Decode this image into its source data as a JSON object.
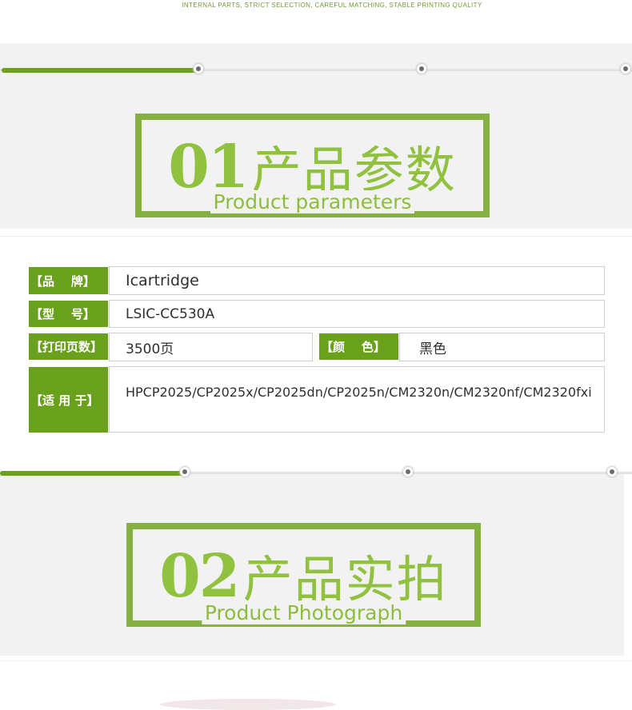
{
  "header": {
    "caption": "INTERNAL PARTS, STRICT SELECTION, CAREFUL MATCHING, STABLE PRINTING QUALITY"
  },
  "section1": {
    "number": "01",
    "title_zh": "产品参数",
    "title_en": "Product parameters"
  },
  "params": {
    "brand_label": "【品    牌】",
    "brand_value": "Icartridge",
    "model_label": "【型    号】",
    "model_value": "LSIC-CC530A",
    "pages_label": "【打印页数】",
    "pages_value": "3500页",
    "color_label": "【颜    色】",
    "color_value": "黑色",
    "fit_label": "【适 用 于】",
    "fit_value": "HPCP2025/CP2025x/CP2025dn/CP2025n/CM2320n/CM2320nf/CM2320fxi"
  },
  "section2": {
    "number": "02",
    "title_zh": "产品实拍",
    "title_en": "Product Photograph"
  },
  "colors": {
    "accent": "#6aa11c",
    "title_green": "#90c13f",
    "frame_green": "#86af44"
  }
}
